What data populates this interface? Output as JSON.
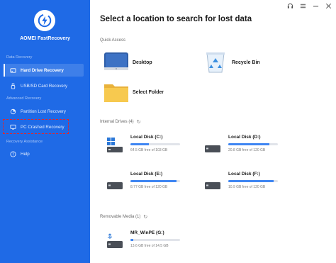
{
  "app": {
    "name": "AOMEI FastRecovery"
  },
  "sidebar": {
    "sections": {
      "data_recovery": "Data Recovery",
      "advanced_recovery": "Advanced Recovery",
      "recovery_assistance": "Recovery Assistance"
    },
    "items": [
      {
        "label": "Hard Drive Recovery",
        "icon": "hard-drive-icon",
        "active": true
      },
      {
        "label": "USB/SD Card Recovery",
        "icon": "usb-icon"
      },
      {
        "label": "Partition Lost Recovery",
        "icon": "partition-icon"
      },
      {
        "label": "PC Crashed Recovery",
        "icon": "monitor-icon"
      },
      {
        "label": "Help",
        "icon": "help-icon"
      }
    ]
  },
  "titlebar": {
    "icons": [
      "headset-icon",
      "menu-icon",
      "minimize-icon",
      "close-icon"
    ]
  },
  "main": {
    "title": "Select a location to search for lost data",
    "quick_access": {
      "label": "Quick Access",
      "items": [
        {
          "label": "Desktop",
          "icon": "desktop-icon"
        },
        {
          "label": "Recycle Bin",
          "icon": "recycle-bin-icon"
        },
        {
          "label": "Select Folder",
          "icon": "folder-icon"
        }
      ]
    },
    "internal_drives": {
      "label": "Internal Drives (4)",
      "drives": [
        {
          "name": "Local Disk (C:)",
          "size": "64.5 GB free of 103 GB",
          "used_fraction": 0.37
        },
        {
          "name": "Local Disk (D:)",
          "size": "20.8 GB free of 120 GB",
          "used_fraction": 0.83
        },
        {
          "name": "Local Disk (E:)",
          "size": "8.77 GB free of 120 GB",
          "used_fraction": 0.93
        },
        {
          "name": "Local Disk (F:)",
          "size": "10.9 GB free of 120 GB",
          "used_fraction": 0.91
        }
      ]
    },
    "removable_media": {
      "label": "Removable Media (1)",
      "drives": [
        {
          "name": "MR_WinPE (G:)",
          "size": "13.6 GB free of 14.5 GB",
          "used_fraction": 0.06
        }
      ]
    }
  },
  "colors": {
    "sidebar": "#1f6ae6",
    "accent": "#3f86f2",
    "highlight": "#e2252b"
  }
}
